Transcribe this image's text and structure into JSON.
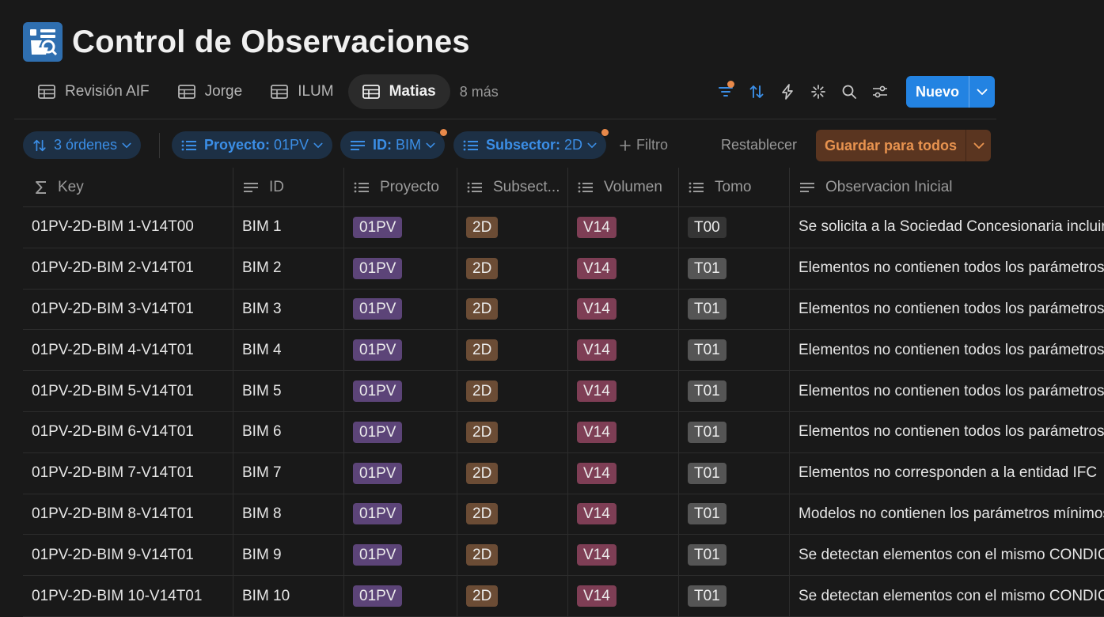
{
  "page": {
    "title": "Control de Observaciones",
    "icon": "document-inspection-icon"
  },
  "tabs": [
    {
      "label": "Revisión AIF",
      "icon": "table-icon",
      "active": false
    },
    {
      "label": "Jorge",
      "icon": "table-icon",
      "active": false
    },
    {
      "label": "ILUM",
      "icon": "table-icon",
      "active": false
    },
    {
      "label": "Matias",
      "icon": "table-icon",
      "active": true
    }
  ],
  "more_tabs": "8 más",
  "toolbar": {
    "icons": [
      "filter-icon",
      "sort-icon",
      "lightning-icon",
      "sparkle-icon",
      "search-icon",
      "settings-sliders-icon"
    ],
    "new_label": "Nuevo"
  },
  "filters": {
    "sorts_label": "3 órdenes",
    "chips": [
      {
        "name": "Proyecto",
        "value": "01PV"
      },
      {
        "name": "ID",
        "value": "BIM"
      },
      {
        "name": "Subsector",
        "value": "2D"
      }
    ],
    "add_filter": "Filtro",
    "reset": "Restablecer",
    "save_all": "Guardar para todos",
    "colors": {
      "chip_text": "#3b8ee6",
      "chip_bg": "#1d3045",
      "save_bg": "#5a3520",
      "save_text": "#e8934f",
      "badge": "#e8894a"
    }
  },
  "table": {
    "columns": [
      {
        "label": "Key",
        "icon": "sigma-icon"
      },
      {
        "label": "ID",
        "icon": "text-lines-icon"
      },
      {
        "label": "Proyecto",
        "icon": "list-icon"
      },
      {
        "label": "Subsect...",
        "icon": "list-icon"
      },
      {
        "label": "Volumen",
        "icon": "list-icon"
      },
      {
        "label": "Tomo",
        "icon": "list-icon"
      },
      {
        "label": "Observacion Inicial",
        "icon": "text-lines-icon"
      }
    ],
    "rows": [
      {
        "key": "01PV-2D-BIM 1-V14T00",
        "id": "BIM 1",
        "proyecto": "01PV",
        "subsector": "2D",
        "volumen": "V14",
        "tomo": "T00",
        "observacion": "Se solicita a la Sociedad Concesionaria incluir"
      },
      {
        "key": "01PV-2D-BIM 2-V14T01",
        "id": "BIM 2",
        "proyecto": "01PV",
        "subsector": "2D",
        "volumen": "V14",
        "tomo": "T01",
        "observacion": "Elementos no contienen todos los parámetros"
      },
      {
        "key": "01PV-2D-BIM 3-V14T01",
        "id": "BIM 3",
        "proyecto": "01PV",
        "subsector": "2D",
        "volumen": "V14",
        "tomo": "T01",
        "observacion": "Elementos no contienen todos los parámetros"
      },
      {
        "key": "01PV-2D-BIM 4-V14T01",
        "id": "BIM 4",
        "proyecto": "01PV",
        "subsector": "2D",
        "volumen": "V14",
        "tomo": "T01",
        "observacion": "Elementos no contienen todos los parámetros"
      },
      {
        "key": "01PV-2D-BIM 5-V14T01",
        "id": "BIM 5",
        "proyecto": "01PV",
        "subsector": "2D",
        "volumen": "V14",
        "tomo": "T01",
        "observacion": "Elementos no contienen todos los parámetros"
      },
      {
        "key": "01PV-2D-BIM 6-V14T01",
        "id": "BIM 6",
        "proyecto": "01PV",
        "subsector": "2D",
        "volumen": "V14",
        "tomo": "T01",
        "observacion": "Elementos no contienen todos los parámetros"
      },
      {
        "key": "01PV-2D-BIM 7-V14T01",
        "id": "BIM 7",
        "proyecto": "01PV",
        "subsector": "2D",
        "volumen": "V14",
        "tomo": "T01",
        "observacion": "Elementos no corresponden a la entidad IFC"
      },
      {
        "key": "01PV-2D-BIM 8-V14T01",
        "id": "BIM 8",
        "proyecto": "01PV",
        "subsector": "2D",
        "volumen": "V14",
        "tomo": "T01",
        "observacion": "Modelos no contienen los parámetros mínimos"
      },
      {
        "key": "01PV-2D-BIM 9-V14T01",
        "id": "BIM 9",
        "proyecto": "01PV",
        "subsector": "2D",
        "volumen": "V14",
        "tomo": "T01",
        "observacion": "Se detectan elementos con el mismo CONDICIÓN"
      },
      {
        "key": "01PV-2D-BIM 10-V14T01",
        "id": "BIM 10",
        "proyecto": "01PV",
        "subsector": "2D",
        "volumen": "V14",
        "tomo": "T01",
        "observacion": "Se detectan elementos con el mismo CONDICIÓN"
      }
    ],
    "tag_colors": {
      "proyecto": "#5c4478",
      "subsector": "#6b4c35",
      "volumen": "#7e3e55",
      "tomo": "#555555",
      "tomo_t00": "#353535"
    }
  }
}
